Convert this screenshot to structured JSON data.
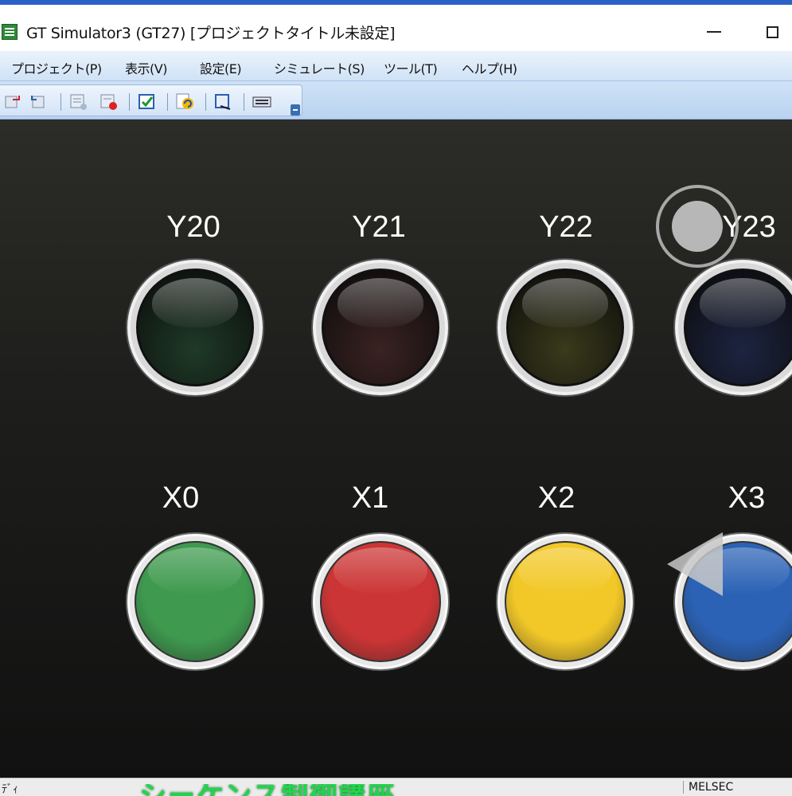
{
  "window": {
    "title": "GT Simulator3 (GT27) [プロジェクトタイトル未設定]",
    "icon": "app-grid-icon"
  },
  "menu": {
    "items": [
      {
        "label": "プロジェクト(P)"
      },
      {
        "label": "表示(V)"
      },
      {
        "label": "設定(E)"
      },
      {
        "label": "シミュレート(S)"
      },
      {
        "label": "ツール(T)"
      },
      {
        "label": "ヘルプ(H)"
      }
    ]
  },
  "toolbar": {
    "buttons": [
      "undo-icon",
      "redo-icon",
      "device-monitor-icon",
      "device-test-icon",
      "screen-check-icon",
      "refresh-icon",
      "debug-icon",
      "keypad-icon"
    ]
  },
  "canvas": {
    "lamps": [
      {
        "label": "Y20",
        "color": "#1f3a27"
      },
      {
        "label": "Y21",
        "color": "#3a2222"
      },
      {
        "label": "Y22",
        "color": "#3a3a1c"
      },
      {
        "label": "Y23",
        "color": "#1c2440"
      }
    ],
    "buttons": [
      {
        "label": "X0",
        "color": "#3f9a4f"
      },
      {
        "label": "X1",
        "color": "#cc3535"
      },
      {
        "label": "X2",
        "color": "#f2c828"
      },
      {
        "label": "X3",
        "color": "#2b62b5"
      }
    ]
  },
  "statusbar": {
    "left_text": "ﾃﾞｨ",
    "right_text": "MELSEC",
    "banner_text": "シーケンス制御講座"
  }
}
